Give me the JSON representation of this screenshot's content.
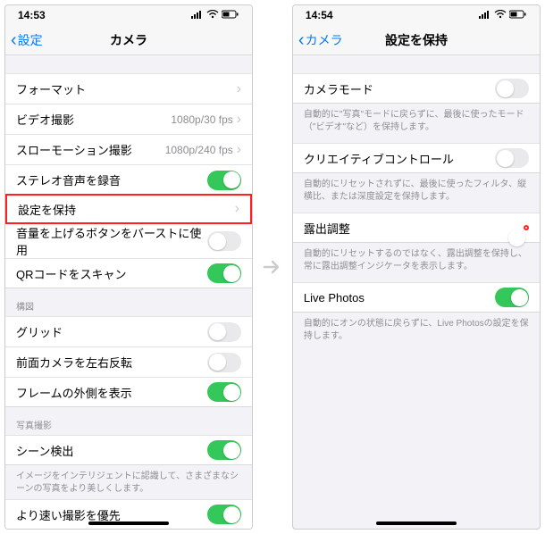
{
  "left": {
    "time": "14:53",
    "back": "設定",
    "title": "カメラ",
    "rows": {
      "format": "フォーマット",
      "video": "ビデオ撮影",
      "video_val": "1080p/30 fps",
      "slomo": "スローモーション撮影",
      "slomo_val": "1080p/240 fps",
      "stereo": "ステレオ音声を録音",
      "preserve": "設定を保持",
      "burst": "音量を上げるボタンをバーストに使用",
      "qr": "QRコードをスキャン"
    },
    "sec_comp": "構図",
    "comp": {
      "grid": "グリッド",
      "mirror": "前面カメラを左右反転",
      "frame": "フレームの外側を表示"
    },
    "sec_photo": "写真撮影",
    "photo": {
      "scene": "シーン検出",
      "scene_note": "イメージをインテリジェントに認識して、さまざまなシーンの写真をより美しくします。",
      "faster": "より速い撮影を優先"
    }
  },
  "right": {
    "time": "14:54",
    "back": "カメラ",
    "title": "設定を保持",
    "mode": "カメラモード",
    "mode_note": "自動的に\"写真\"モードに戻らずに、最後に使ったモード（\"ビデオ\"など）を保持します。",
    "creative": "クリエイティブコントロール",
    "creative_note": "自動的にリセットされずに、最後に使ったフィルタ、縦横比、または深度設定を保持します。",
    "exposure": "露出調整",
    "exposure_note": "自動的にリセットするのではなく、露出調整を保持し、常に露出調整インジケータを表示します。",
    "live": "Live Photos",
    "live_note": "自動的にオンの状態に戻らずに、Live Photosの設定を保持します。"
  }
}
